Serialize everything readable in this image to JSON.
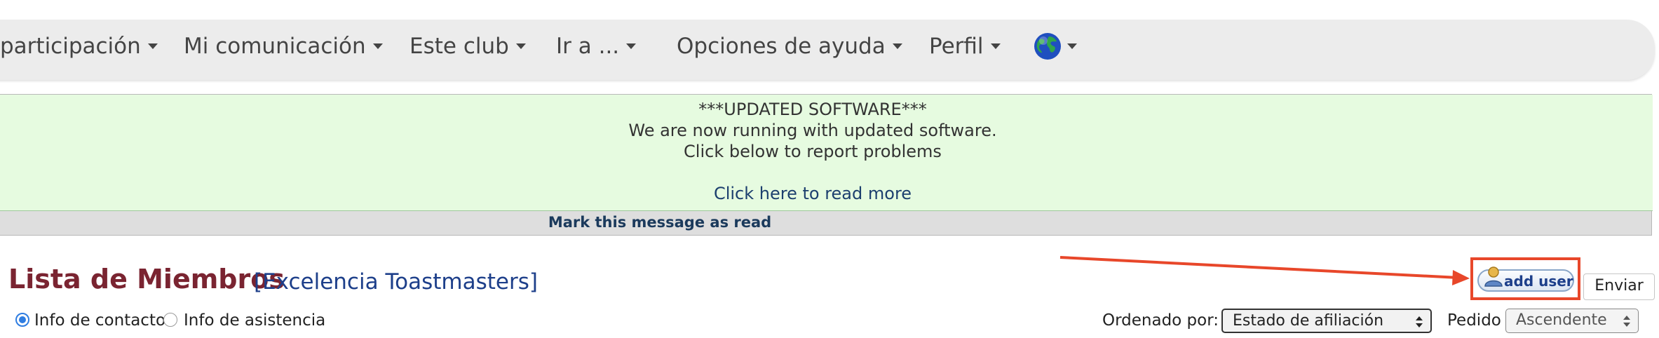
{
  "nav": {
    "items": [
      {
        "label": "participación"
      },
      {
        "label": "Mi comunicación"
      },
      {
        "label": "Este club"
      },
      {
        "label": "Ir a ..."
      },
      {
        "label": "Opciones de ayuda"
      },
      {
        "label": "Perfil"
      }
    ],
    "language_icon": "globe-icon"
  },
  "notice": {
    "heading": "***UPDATED SOFTWARE***",
    "line1": "We are now running with updated software.",
    "line2": "Click below to report problems",
    "link": "Click here to read more",
    "mark_read": "Mark this message as read"
  },
  "page": {
    "title": "Lista de Miembros",
    "club": "[Excelencia Toastmasters]"
  },
  "toolbar": {
    "add_user": "add user",
    "add_user_icon": "user-add-icon",
    "send": "Enviar"
  },
  "view": {
    "contact_info": "Info de contacto",
    "attendance_info": "Info de asistencia",
    "selected": "contact_info"
  },
  "sort": {
    "label": "Ordenado por:",
    "value": "Estado de afiliación",
    "order_label": "Pedido",
    "order_value": "Ascendente"
  },
  "colors": {
    "annotation": "#e8472a",
    "title": "#7a2431",
    "link": "#1d3f8a",
    "notice_bg": "#e6fbe0"
  }
}
